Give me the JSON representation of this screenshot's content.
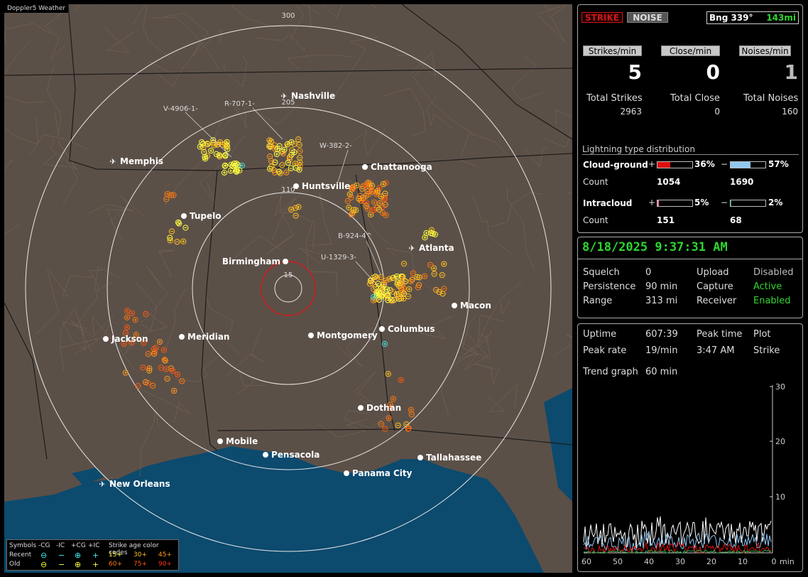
{
  "app": {
    "title": "Doppler5 Weather"
  },
  "header": {
    "strike_btn": "STRIKE",
    "noise_btn": "NOISE",
    "bearing_label": "Bng 339°",
    "bearing_distance": "143mi"
  },
  "rates": {
    "strikes_label": "Strikes/min",
    "strikes_value": "5",
    "close_label": "Close/min",
    "close_value": "0",
    "noises_label": "Noises/min",
    "noises_value": "1"
  },
  "totals": {
    "strikes_label": "Total Strikes",
    "strikes_value": "2963",
    "close_label": "Total Close",
    "close_value": "0",
    "noises_label": "Total Noises",
    "noises_value": "160"
  },
  "distribution": {
    "title": "Lightning type distribution",
    "cg_label": "Cloud-ground",
    "ic_label": "Intracloud",
    "count_label": "Count",
    "plus": "+",
    "minus": "−",
    "cg_pos_pct": "36%",
    "cg_pos_value": 0.36,
    "cg_neg_pct": "57%",
    "cg_neg_value": 0.57,
    "cg_pos_count": "1054",
    "cg_neg_count": "1690",
    "ic_pos_pct": "5%",
    "ic_pos_value": 0.05,
    "ic_neg_pct": "2%",
    "ic_neg_value": 0.02,
    "ic_pos_count": "151",
    "ic_neg_count": "68",
    "colors": {
      "cg_pos": "#e01010",
      "cg_neg": "#90c8f0",
      "ic_pos": "#ff77aa",
      "ic_neg": "#20a060"
    }
  },
  "status": {
    "datetime": "8/18/2025 9:37:31 AM",
    "squelch_label": "Squelch",
    "squelch_value": "0",
    "persistence_label": "Persistence",
    "persistence_value": "90 min",
    "range_label": "Range",
    "range_value": "313 mi",
    "upload_label": "Upload",
    "upload_value": "Disabled",
    "capture_label": "Capture",
    "capture_value": "Active",
    "receiver_label": "Receiver",
    "receiver_value": "Enabled"
  },
  "stats": {
    "uptime_label": "Uptime",
    "uptime_value": "607:39",
    "peak_time_label": "Peak time",
    "peak_time_value": "3:47 AM",
    "plot_label": "Plot",
    "plot_value": "Strike",
    "peak_rate_label": "Peak rate",
    "peak_rate_value": "19/min",
    "trend_label": "Trend graph",
    "trend_value": "60 min"
  },
  "trend": {
    "y_ticks": [
      "30",
      "20",
      "10"
    ],
    "x_ticks": [
      "60",
      "50",
      "40",
      "30",
      "20",
      "10",
      "0"
    ],
    "x_unit": "min",
    "series_colors": {
      "strikes": "#ffffff",
      "cg_neg": "#8fc4ee",
      "cg_pos": "#e01010",
      "ic": "#30b050"
    }
  },
  "map": {
    "ring_labels": [
      "300",
      "205",
      "110",
      "15"
    ],
    "cities": [
      {
        "name": "Nashville",
        "type": "airport"
      },
      {
        "name": "Memphis",
        "type": "airport"
      },
      {
        "name": "Chattanooga",
        "type": "city"
      },
      {
        "name": "Huntsville",
        "type": "city"
      },
      {
        "name": "Tupelo",
        "type": "city"
      },
      {
        "name": "Atlanta",
        "type": "airport"
      },
      {
        "name": "Birmingham",
        "type": "city"
      },
      {
        "name": "Macon",
        "type": "city"
      },
      {
        "name": "Jackson",
        "type": "city"
      },
      {
        "name": "Meridian",
        "type": "city"
      },
      {
        "name": "Montgomery",
        "type": "city"
      },
      {
        "name": "Columbus",
        "type": "city"
      },
      {
        "name": "Dothan",
        "type": "city"
      },
      {
        "name": "Mobile",
        "type": "city"
      },
      {
        "name": "Pensacola",
        "type": "city"
      },
      {
        "name": "Tallahassee",
        "type": "city"
      },
      {
        "name": "Panama City",
        "type": "city"
      },
      {
        "name": "New Orleans",
        "type": "airport"
      }
    ],
    "storm_tags": [
      "V-4906-1-",
      "R-707-1-",
      "W-382-2-",
      "B-924-4^",
      "U-1329-3-"
    ],
    "colors": {
      "land": "#5b5048",
      "water": "#0c4a6e",
      "ring": "#e8e8e8",
      "close_ring": "#d01818"
    }
  },
  "legend": {
    "symbols_label": "Symbols",
    "recent_label": "Recent",
    "old_label": "Old",
    "col_cg_neg": "-CG",
    "col_ic_neg": "-IC",
    "col_cg_pos": "+CG",
    "col_ic_pos": "+IC",
    "age_title": "Strike age color codes",
    "ages": [
      "15+",
      "30+",
      "45+",
      "60+",
      "75+",
      "90+"
    ],
    "age_colors": [
      "#ffff40",
      "#ffc020",
      "#ff9a20",
      "#ff7a10",
      "#ff5a10",
      "#ff3010"
    ]
  }
}
